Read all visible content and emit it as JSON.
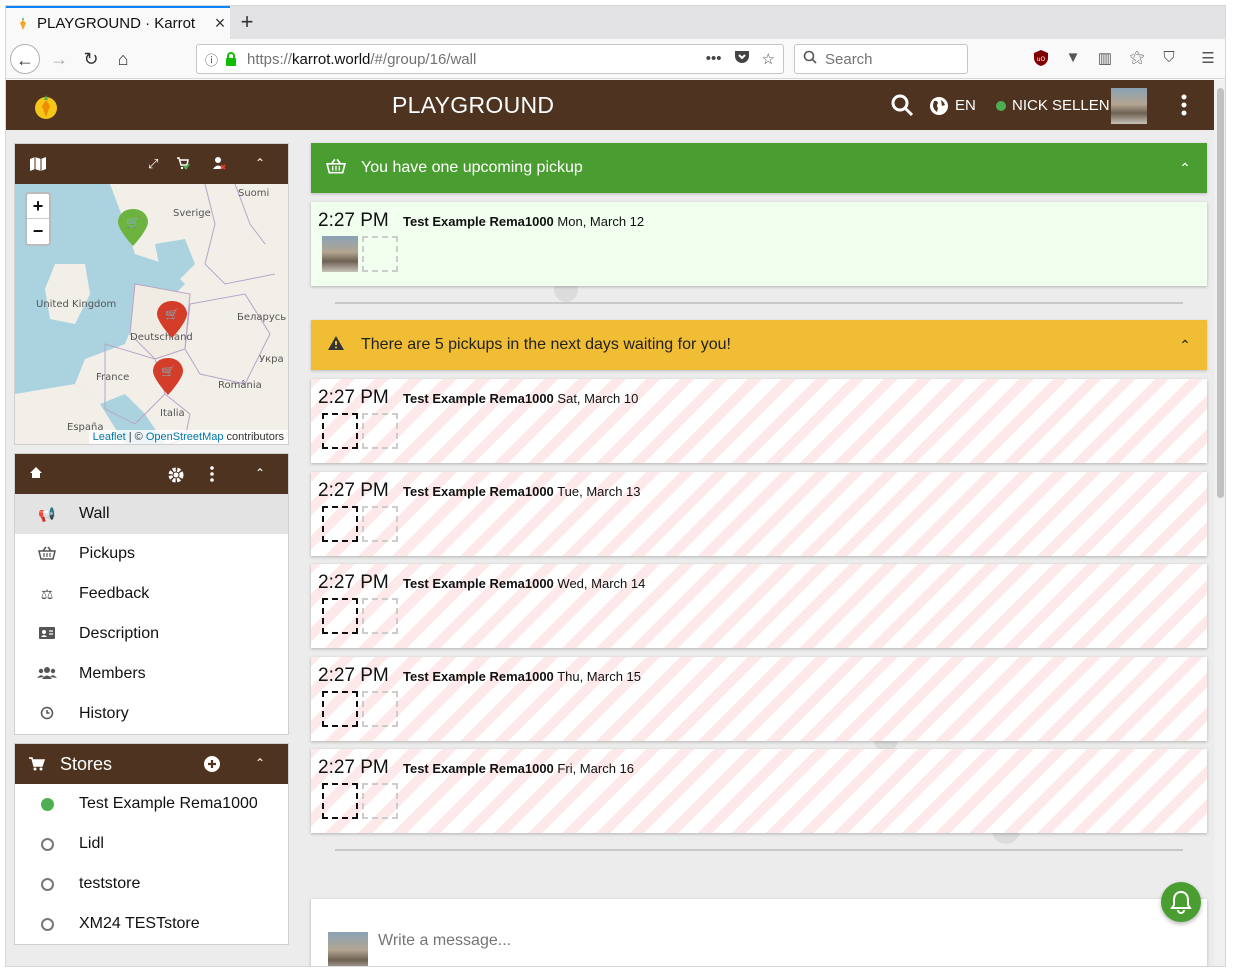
{
  "browser": {
    "tab_title": "PLAYGROUND · Karrot",
    "url_prefix": "https://",
    "url_host": "karrot.world",
    "url_path": "/#/group/16/wall",
    "search_placeholder": "Search",
    "more_dots": "•••"
  },
  "appbar": {
    "title": "PLAYGROUND",
    "language": "EN",
    "user_name": "NICK SELLEN",
    "status_color": "#4caf50"
  },
  "map": {
    "zoom_in": "+",
    "zoom_out": "−",
    "labels": [
      "Suomi",
      "Sverige",
      "United Kingdom",
      "Беларусь",
      "Deutschland",
      "Укра",
      "France",
      "România",
      "Italia",
      "España"
    ],
    "attribution_leaflet": "Leaflet",
    "attribution_sep": " | © ",
    "attribution_osm": "OpenStreetMap",
    "attribution_tail": " contributors"
  },
  "nav": {
    "items": [
      {
        "label": "Wall",
        "icon": "megaphone-icon"
      },
      {
        "label": "Pickups",
        "icon": "basket-icon"
      },
      {
        "label": "Feedback",
        "icon": "balance-scale-icon"
      },
      {
        "label": "Description",
        "icon": "address-card-icon"
      },
      {
        "label": "Members",
        "icon": "users-icon"
      },
      {
        "label": "History",
        "icon": "clock-icon"
      }
    ]
  },
  "stores": {
    "title": "Stores",
    "items": [
      {
        "label": "Test Example Rema1000",
        "active": true
      },
      {
        "label": "Lidl",
        "active": false
      },
      {
        "label": "teststore",
        "active": false
      },
      {
        "label": "XM24 TESTstore",
        "active": false
      }
    ]
  },
  "upcoming": {
    "banner": "You have one upcoming pickup",
    "pickup": {
      "time": "2:27 PM",
      "store": "Test Example Rema1000",
      "date": "Mon, March 12"
    }
  },
  "waiting": {
    "banner": "There are 5 pickups in the next days waiting for you!",
    "pickups": [
      {
        "time": "2:27 PM",
        "store": "Test Example Rema1000",
        "date": "Sat, March 10"
      },
      {
        "time": "2:27 PM",
        "store": "Test Example Rema1000",
        "date": "Tue, March 13"
      },
      {
        "time": "2:27 PM",
        "store": "Test Example Rema1000",
        "date": "Wed, March 14"
      },
      {
        "time": "2:27 PM",
        "store": "Test Example Rema1000",
        "date": "Thu, March 15"
      },
      {
        "time": "2:27 PM",
        "store": "Test Example Rema1000",
        "date": "Fri, March 16"
      }
    ]
  },
  "composer": {
    "placeholder": "Write a message..."
  },
  "colors": {
    "brand_brown": "#4e3420",
    "green": "#4a9e31",
    "yellow": "#f0bd34"
  }
}
